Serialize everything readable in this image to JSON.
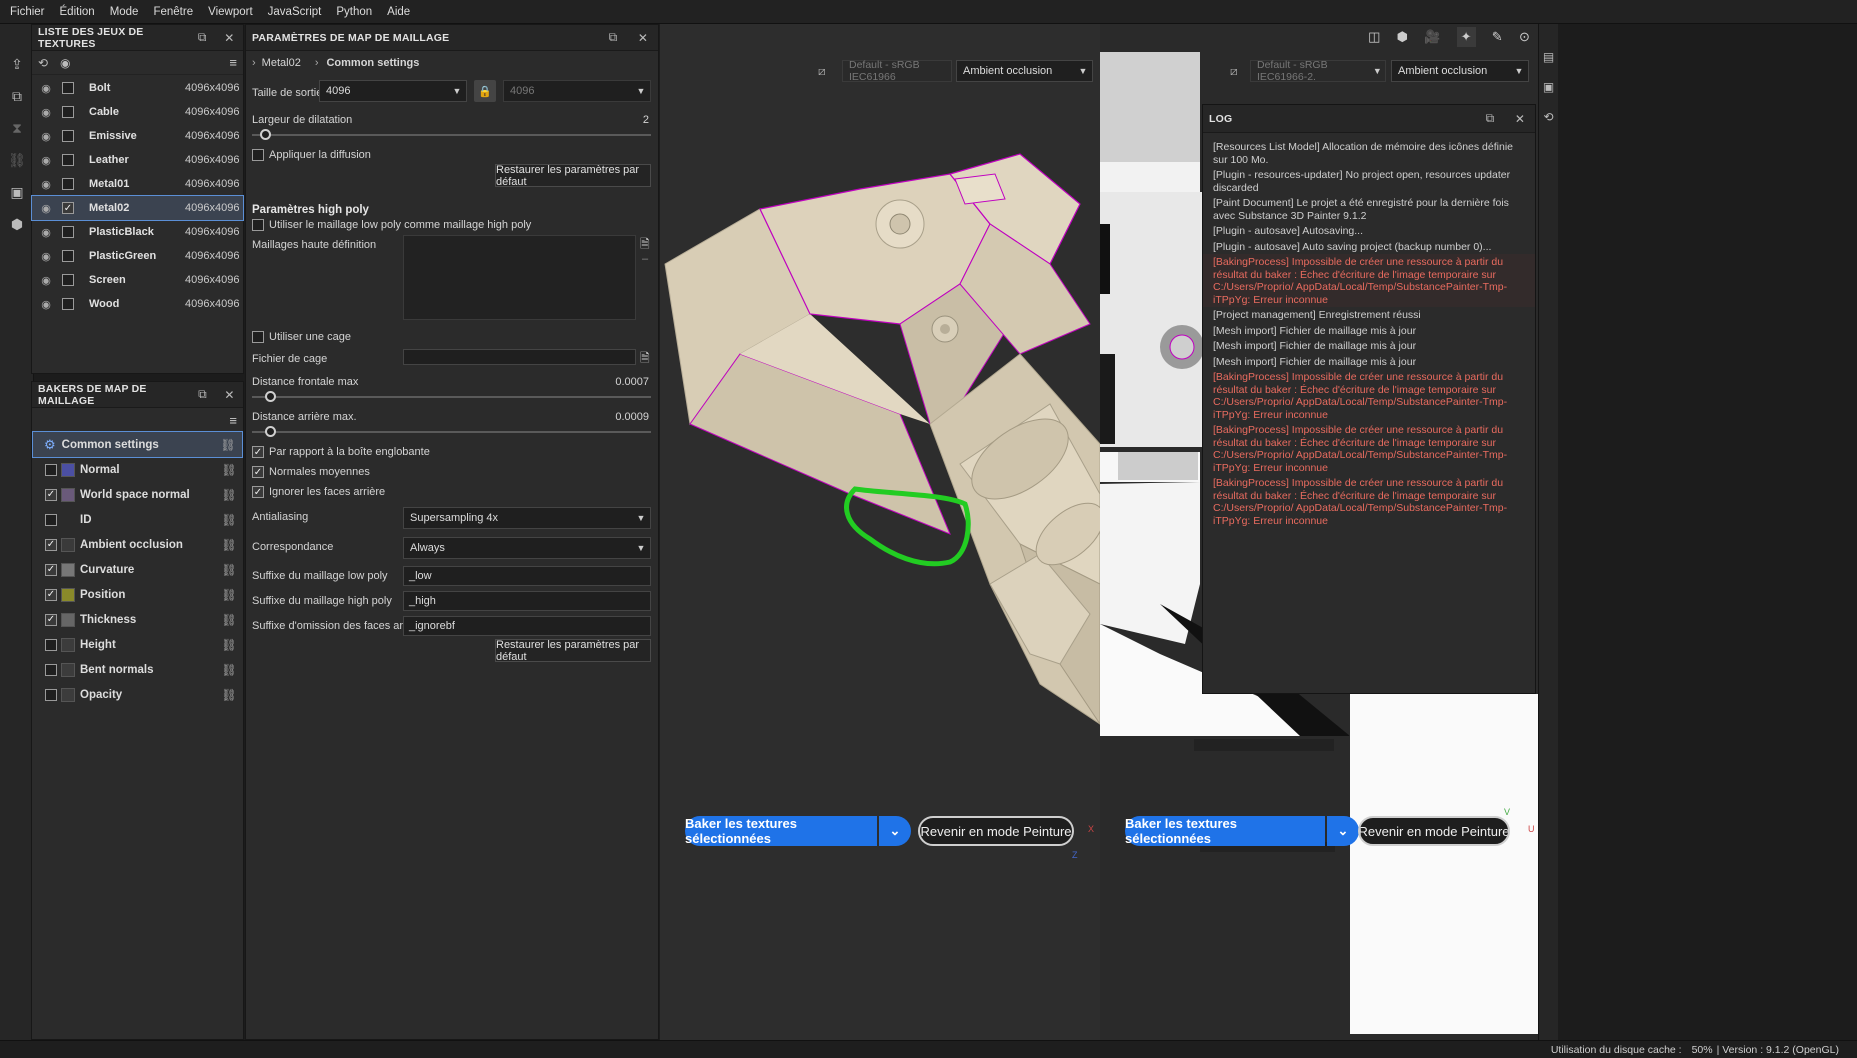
{
  "menu": [
    "Fichier",
    "Édition",
    "Mode",
    "Fenêtre",
    "Viewport",
    "JavaScript",
    "Python",
    "Aide"
  ],
  "texture_sets": {
    "title": "LISTE DES JEUX DE TEXTURES",
    "items": [
      {
        "name": "Bolt",
        "res": "4096x4096",
        "checked": false
      },
      {
        "name": "Cable",
        "res": "4096x4096",
        "checked": false
      },
      {
        "name": "Emissive",
        "res": "4096x4096",
        "checked": false
      },
      {
        "name": "Leather",
        "res": "4096x4096",
        "checked": false
      },
      {
        "name": "Metal01",
        "res": "4096x4096",
        "checked": false
      },
      {
        "name": "Metal02",
        "res": "4096x4096",
        "checked": true
      },
      {
        "name": "PlasticBlack",
        "res": "4096x4096",
        "checked": false
      },
      {
        "name": "PlasticGreen",
        "res": "4096x4096",
        "checked": false
      },
      {
        "name": "Screen",
        "res": "4096x4096",
        "checked": false
      },
      {
        "name": "Wood",
        "res": "4096x4096",
        "checked": false
      }
    ]
  },
  "bakers": {
    "title": "BAKERS DE MAP DE MAILLAGE",
    "common": "Common settings",
    "items": [
      {
        "name": "Normal",
        "checked": false,
        "thumb": "#4b4fa3"
      },
      {
        "name": "World space normal",
        "checked": true,
        "thumb": "#6a5a7a"
      },
      {
        "name": "ID",
        "checked": false,
        "thumb": ""
      },
      {
        "name": "Ambient occlusion",
        "checked": true,
        "thumb": "#3a3a3a"
      },
      {
        "name": "Curvature",
        "checked": true,
        "thumb": "#777777"
      },
      {
        "name": "Position",
        "checked": true,
        "thumb": "#8a8a2a"
      },
      {
        "name": "Thickness",
        "checked": true,
        "thumb": "#666666"
      },
      {
        "name": "Height",
        "checked": false,
        "thumb": "#3c3c3c"
      },
      {
        "name": "Bent normals",
        "checked": false,
        "thumb": "#3c3c3c"
      },
      {
        "name": "Opacity",
        "checked": false,
        "thumb": "#3c3c3c"
      }
    ]
  },
  "params": {
    "title": "PARAMÈTRES DE MAP DE MAILLAGE",
    "crumb1": "Metal02",
    "crumb2": "Common settings",
    "output_size_label": "Taille de sortie",
    "output_size": "4096",
    "output_size_locked": "4096",
    "dilation_label": "Largeur de dilatation",
    "dilation_value": "2",
    "apply_diffusion": "Appliquer la diffusion",
    "restore1": "Restaurer les paramètres par défaut",
    "highpoly_header": "Paramètres high poly",
    "use_lowpoly": "Utiliser le maillage low poly comme maillage high poly",
    "hd_meshes": "Maillages haute définition",
    "use_cage": "Utiliser une cage",
    "cage_file": "Fichier de cage",
    "front_dist_label": "Distance frontale max",
    "front_dist_value": "0.0007",
    "back_dist_label": "Distance arrière max.",
    "back_dist_value": "0.0009",
    "relative_bbox": "Par rapport à la boîte englobante",
    "avg_normals": "Normales moyennes",
    "ignore_backface": "Ignorer les faces arrière",
    "antialiasing_label": "Antialiasing",
    "antialiasing": "Supersampling 4x",
    "match_label": "Correspondance",
    "match": "Always",
    "lowpoly_suffix_label": "Suffixe du maillage low poly",
    "lowpoly_suffix": "_low",
    "highpoly_suffix_label": "Suffixe du maillage high poly",
    "highpoly_suffix": "_high",
    "ignorebf_suffix_label": "Suffixe d'omission des faces arrière",
    "ignorebf_suffix": "_ignorebf",
    "restore2": "Restaurer les paramètres par défaut"
  },
  "viewport": {
    "colorspace": "Default - sRGB IEC61966",
    "colorspace2": "Default - sRGB IEC61966-2.",
    "channel": "Ambient occlusion",
    "bake_button": "Baker les textures sélectionnées",
    "return_button": "Revenir en mode Peinture",
    "axis_x": "X",
    "axis_z": "Z",
    "axis_u": "U",
    "axis_v": "V"
  },
  "log": {
    "title": "LOG",
    "lines": [
      {
        "t": "[Resources List Model] Allocation de mémoire des icônes définie sur 100 Mo.",
        "k": "n"
      },
      {
        "t": "[Plugin - resources-updater] No project open, resources updater discarded",
        "k": "n"
      },
      {
        "t": "[Paint Document] Le projet a été enregistré pour la dernière fois avec Substance 3D Painter 9.1.2",
        "k": "n"
      },
      {
        "t": "[Plugin - autosave] Autosaving...",
        "k": "n"
      },
      {
        "t": "[Plugin - autosave] Auto saving project (backup number 0)...",
        "k": "n"
      },
      {
        "t": "[BakingProcess] Impossible de créer une ressource à partir du résultat du baker : Échec d'écriture de l'image temporaire sur C:/Users/Proprio/ AppData/Local/Temp/SubstancePainter-Tmp-iTPpYg: Erreur inconnue",
        "k": "eh"
      },
      {
        "t": "[Project management] Enregistrement réussi",
        "k": "n"
      },
      {
        "t": "[Mesh import] Fichier de maillage mis à jour",
        "k": "n"
      },
      {
        "t": "[Mesh import] Fichier de maillage mis à jour",
        "k": "n"
      },
      {
        "t": "[Mesh import] Fichier de maillage mis à jour",
        "k": "n"
      },
      {
        "t": "[BakingProcess] Impossible de créer une ressource à partir du résultat du baker : Échec d'écriture de l'image temporaire sur C:/Users/Proprio/ AppData/Local/Temp/SubstancePainter-Tmp-iTPpYg: Erreur inconnue",
        "k": "e"
      },
      {
        "t": "[BakingProcess] Impossible de créer une ressource à partir du résultat du baker : Échec d'écriture de l'image temporaire sur C:/Users/Proprio/ AppData/Local/Temp/SubstancePainter-Tmp-iTPpYg: Erreur inconnue",
        "k": "e"
      },
      {
        "t": "[BakingProcess] Impossible de créer une ressource à partir du résultat du baker : Échec d'écriture de l'image temporaire sur C:/Users/Proprio/ AppData/Local/Temp/SubstancePainter-Tmp-iTPpYg: Erreur inconnue",
        "k": "e"
      }
    ]
  },
  "status": {
    "cache_label": "Utilisation du disque cache :",
    "cache_value": "50%",
    "version": "| Version : 9.1.2 (OpenGL)"
  },
  "colors": {
    "accent": "#1f73e8",
    "error": "#e86b5f",
    "selection": "#3b4350",
    "mesh": "#d9cfb8",
    "edge": "#c000c0",
    "annotation": "#22cc22"
  }
}
